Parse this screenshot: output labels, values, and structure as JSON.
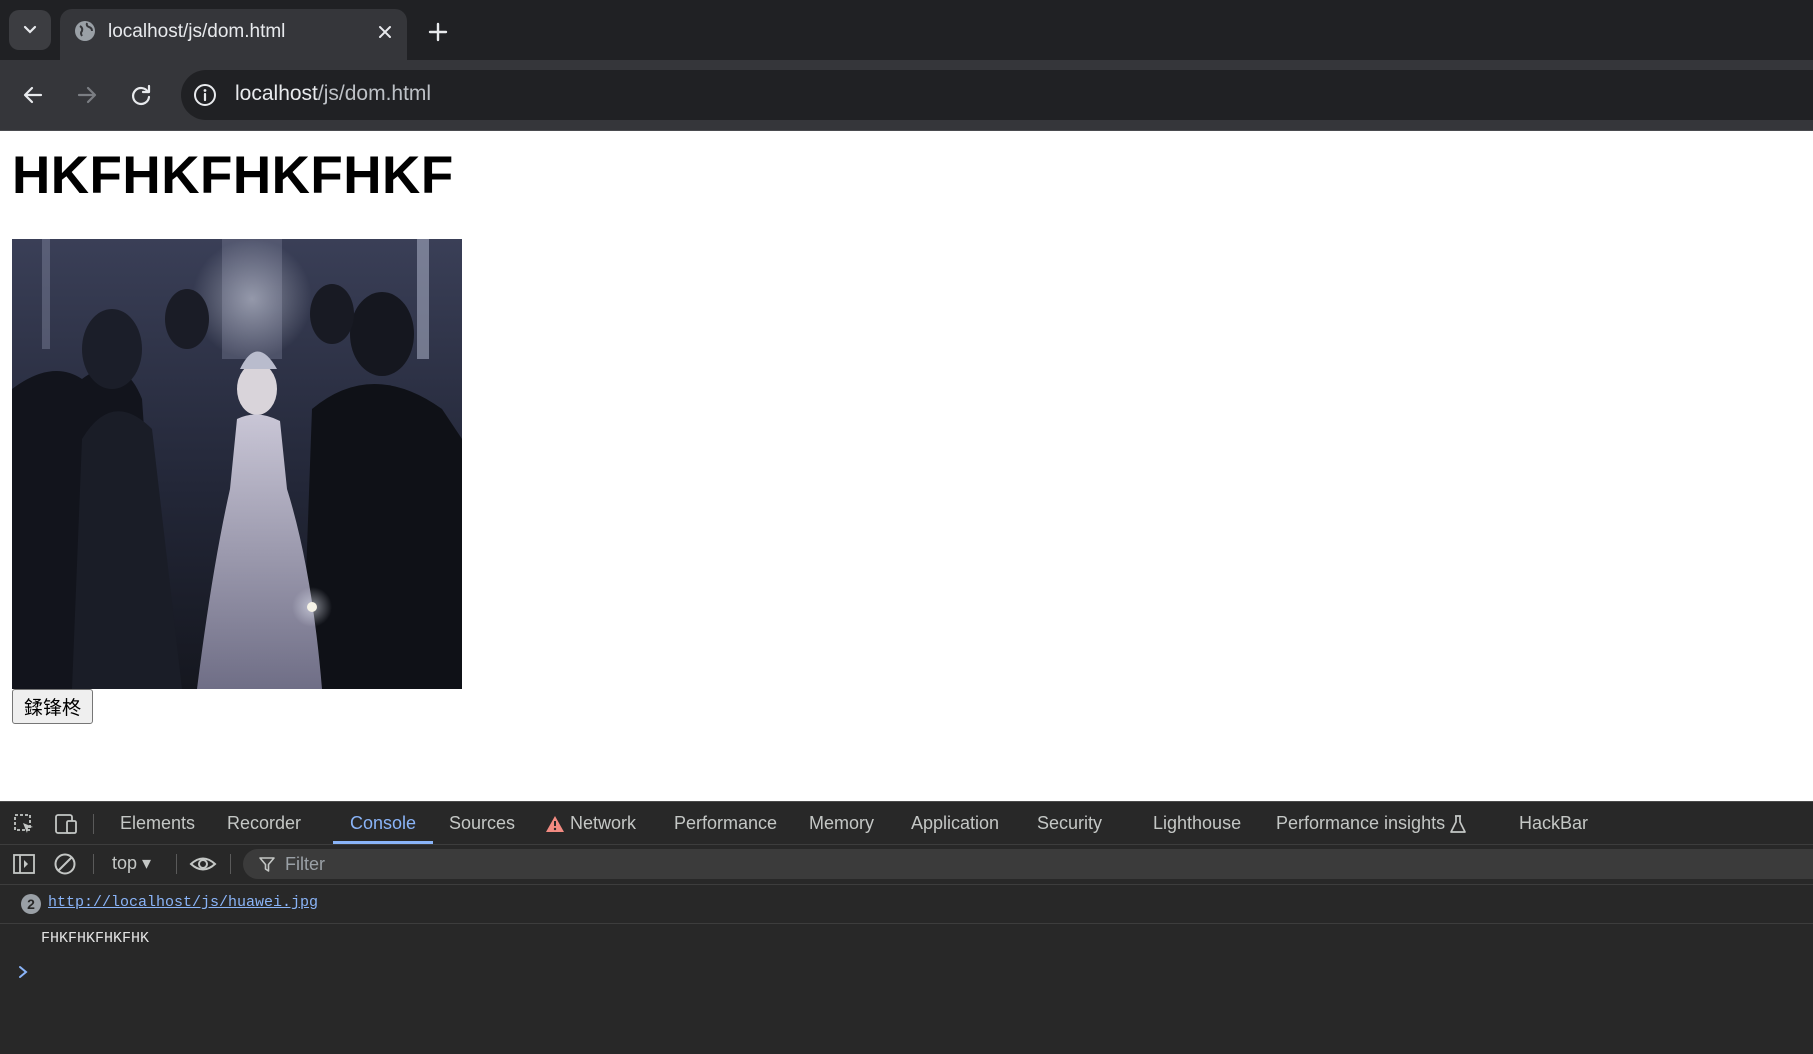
{
  "browser": {
    "tab": {
      "title": "localhost/js/dom.html"
    },
    "address": {
      "host": "localhost",
      "path": "/js/dom.html"
    }
  },
  "page": {
    "heading": "HKFHKFHKFHKF",
    "image_alt": "huawei.jpg",
    "button_label": "鍒锋柊"
  },
  "devtools": {
    "tabs": [
      "Elements",
      "Recorder",
      "Console",
      "Sources",
      "Network",
      "Performance",
      "Memory",
      "Application",
      "Security",
      "Lighthouse",
      "Performance insights",
      "HackBar"
    ],
    "active_tab": "Console",
    "context": "top",
    "filter_placeholder": "Filter",
    "messages": [
      {
        "count": "2",
        "text": "http://localhost/js/huawei.jpg",
        "type": "link"
      },
      {
        "text": "FHKFHKFHKFHK",
        "type": "text"
      }
    ],
    "colors": {
      "accent": "#8ab4f8",
      "warning": "#f28b82"
    }
  }
}
